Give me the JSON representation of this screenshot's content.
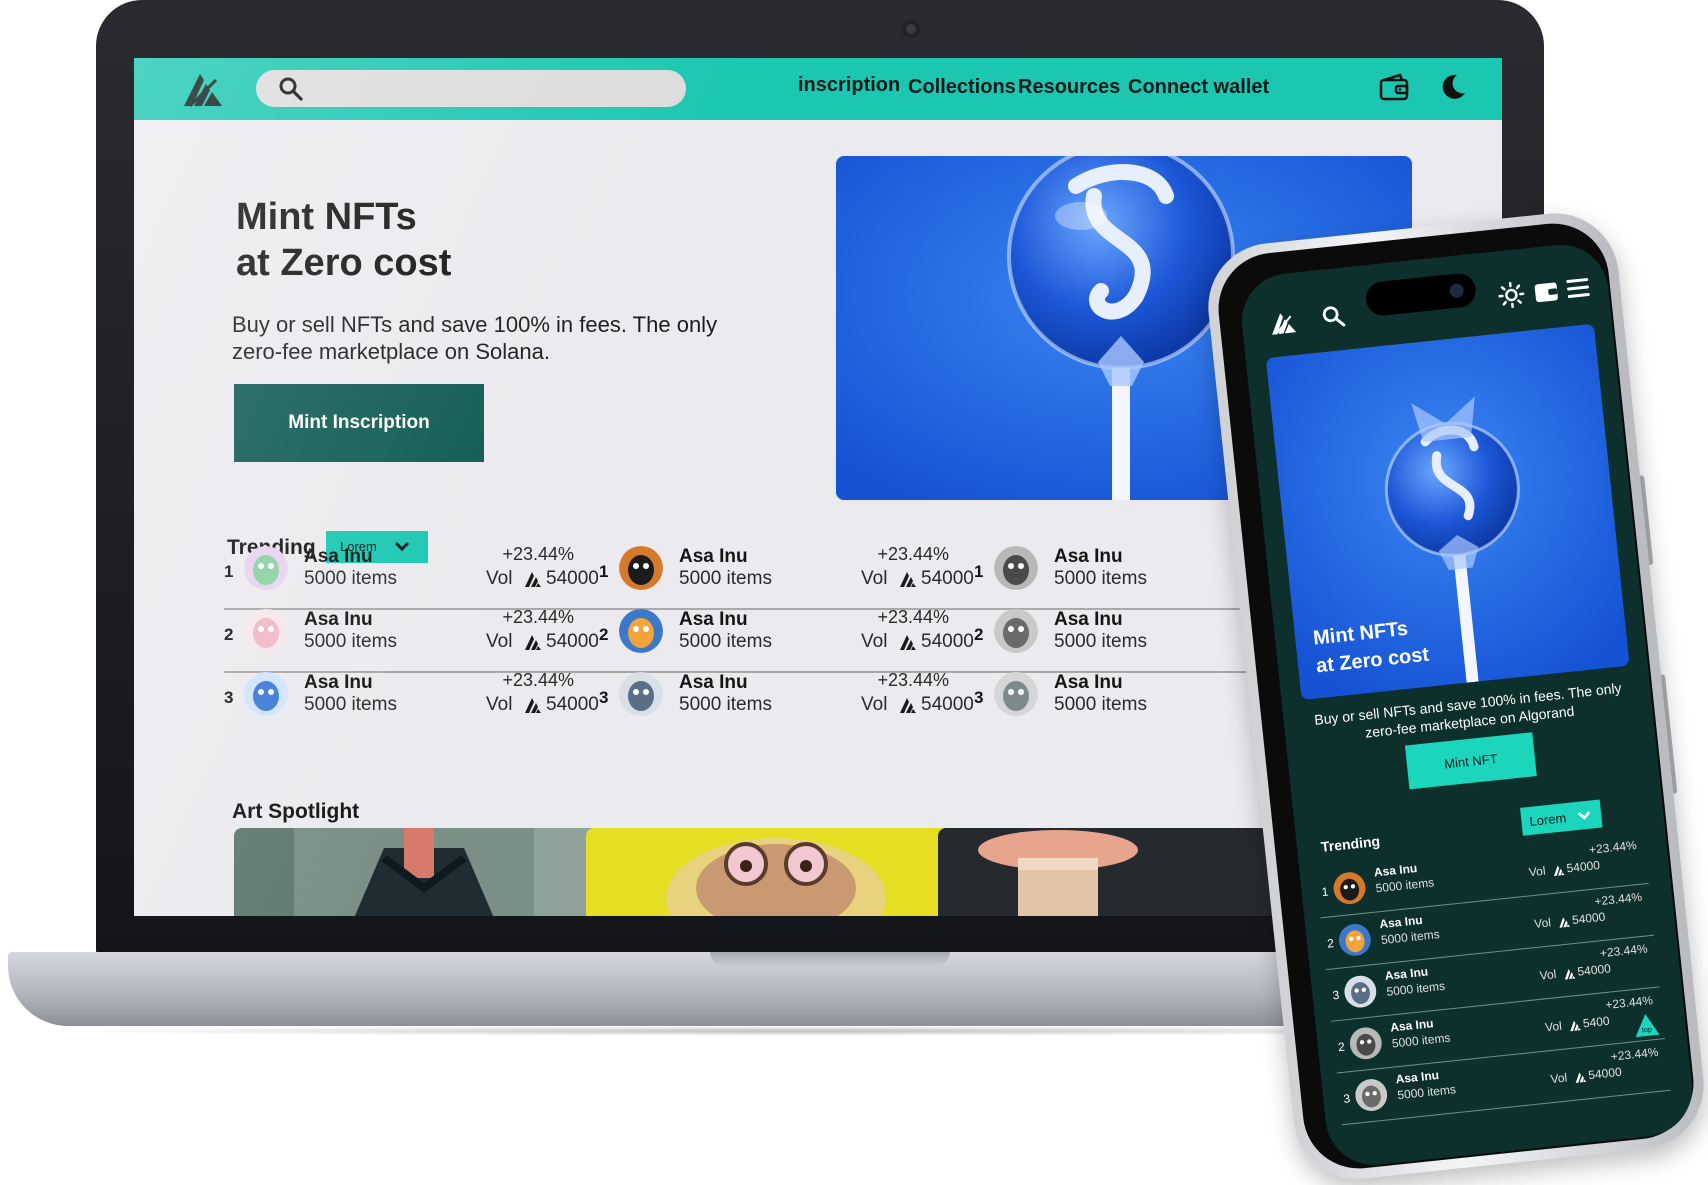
{
  "desktop": {
    "nav": {
      "links": [
        "inscription",
        "Collections",
        "Resources",
        "Connect wallet"
      ],
      "search_placeholder": ""
    },
    "hero": {
      "title_line1": "Mint NFTs",
      "title_line2": "at Zero cost",
      "subtitle": "Buy or sell NFTs and save 100% in fees. The only zero-fee marketplace on Solana.",
      "button": "Mint Inscription"
    },
    "trending": {
      "title": "Trending",
      "select": "Lorem",
      "columns": [
        [
          {
            "rank": "1",
            "name": "Asa Inu",
            "items": "5000 items",
            "change": "+23.44%",
            "vol_label": "Vol",
            "vol": "54000"
          },
          {
            "rank": "2",
            "name": "Asa Inu",
            "items": "5000 items",
            "change": "+23.44%",
            "vol_label": "Vol",
            "vol": "54000"
          },
          {
            "rank": "3",
            "name": "Asa Inu",
            "items": "5000 items",
            "change": "+23.44%",
            "vol_label": "Vol",
            "vol": "54000"
          }
        ],
        [
          {
            "rank": "1",
            "name": "Asa Inu",
            "items": "5000 items",
            "change": "+23.44%",
            "vol_label": "Vol",
            "vol": "54000"
          },
          {
            "rank": "2",
            "name": "Asa Inu",
            "items": "5000 items",
            "change": "+23.44%",
            "vol_label": "Vol",
            "vol": "54000"
          },
          {
            "rank": "3",
            "name": "Asa Inu",
            "items": "5000 items",
            "change": "+23.44%",
            "vol_label": "Vol",
            "vol": "54000"
          }
        ],
        [
          {
            "rank": "1",
            "name": "Asa Inu",
            "items": "5000 items"
          },
          {
            "rank": "2",
            "name": "Asa Inu",
            "items": "5000 items"
          },
          {
            "rank": "3",
            "name": "Asa Inu",
            "items": "5000 items"
          }
        ]
      ]
    },
    "art_spotlight": {
      "title": "Art Spotlight"
    }
  },
  "mobile": {
    "hero": {
      "title_line1": "Mint NFTs",
      "title_line2": "at Zero cost",
      "subtitle": "Buy or sell NFTs and save 100% in fees. The only zero-fee marketplace on Algorand",
      "button": "Mint  NFT"
    },
    "trending": {
      "title": "Trending",
      "select": "Lorem",
      "rows": [
        {
          "rank": "1",
          "name": "Asa Inu",
          "items": "5000 items",
          "change": "+23.44%",
          "vol_label": "Vol",
          "vol": "54000"
        },
        {
          "rank": "2",
          "name": "Asa Inu",
          "items": "5000 items",
          "change": "+23.44%",
          "vol_label": "Vol",
          "vol": "54000"
        },
        {
          "rank": "3",
          "name": "Asa Inu",
          "items": "5000 items",
          "change": "+23.44%",
          "vol_label": "Vol",
          "vol": "54000"
        },
        {
          "rank": "2",
          "name": "Asa Inu",
          "items": "5000 items",
          "change": "+23.44%",
          "vol_label": "Vol",
          "vol": "5400"
        },
        {
          "rank": "3",
          "name": "Asa Inu",
          "items": "5000 items",
          "change": "+23.44%",
          "vol_label": "Vol",
          "vol": "54000"
        }
      ]
    },
    "top_button": "top"
  },
  "colors": {
    "accent": "#1bc7b1",
    "primary_button": "#0f5b53",
    "mobile_bg": "#0d302c",
    "hero_blue": "#1a68e6"
  },
  "icons": [
    "logo-icon",
    "search-icon",
    "wallet-icon",
    "moon-icon",
    "sun-icon",
    "menu-icon",
    "chevron-down-icon",
    "algo-icon"
  ]
}
